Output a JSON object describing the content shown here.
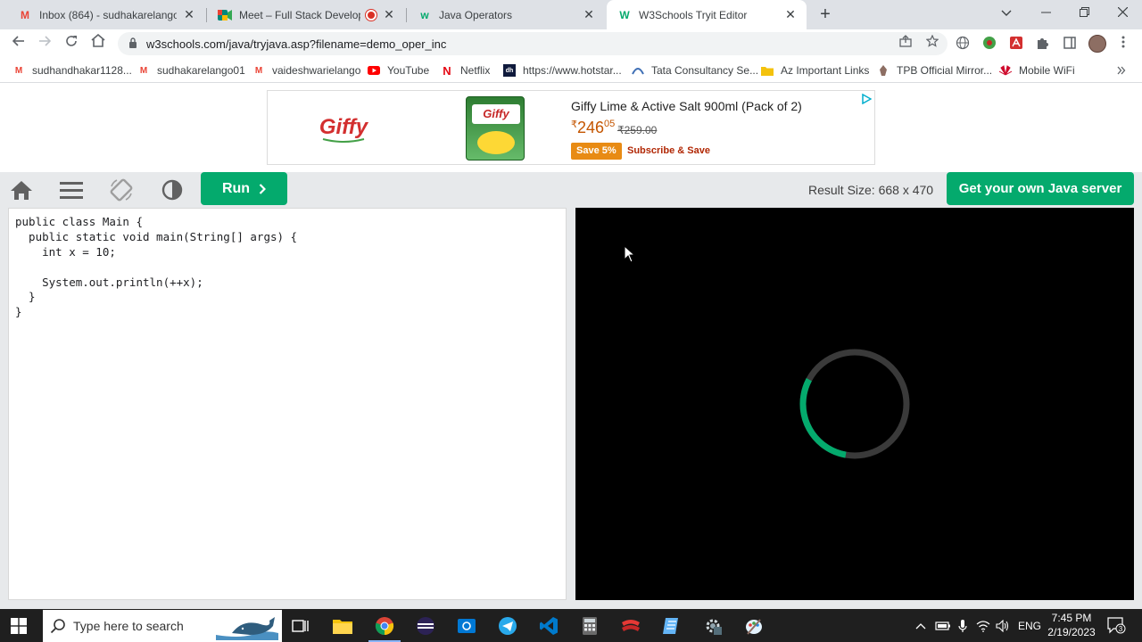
{
  "browser": {
    "tabs": [
      {
        "title": "Inbox (864) - sudhakarelango01@",
        "icon": "gmail-icon",
        "color": "#ea4335"
      },
      {
        "title": "Meet – Full Stack Developer",
        "icon": "google-meet-icon",
        "color": "#00897b"
      },
      {
        "title": "Java Operators",
        "icon": "w3schools-icon",
        "color": "#04aa6d"
      },
      {
        "title": "W3Schools Tryit Editor",
        "icon": "w3schools-icon",
        "color": "#04aa6d"
      }
    ],
    "close_glyph": "✕",
    "new_tab_glyph": "+",
    "url": "w3schools.com/java/tryjava.asp?filename=demo_oper_inc"
  },
  "bookmarks": [
    {
      "label": "sudhandhakar1128...",
      "icon": "gmail-icon"
    },
    {
      "label": "sudhakarelango01",
      "icon": "gmail-icon"
    },
    {
      "label": "vaideshwarielango",
      "icon": "gmail-icon"
    },
    {
      "label": "YouTube",
      "icon": "youtube-icon"
    },
    {
      "label": "Netflix",
      "icon": "netflix-icon"
    },
    {
      "label": "https://www.hotstar...",
      "icon": "hotstar-icon"
    },
    {
      "label": "Tata Consultancy Se...",
      "icon": "tcs-icon"
    },
    {
      "label": "Az Important Links",
      "icon": "folder-icon"
    },
    {
      "label": "TPB Official Mirror...",
      "icon": "tpb-icon"
    },
    {
      "label": "Mobile WiFi",
      "icon": "huawei-icon"
    }
  ],
  "ad": {
    "brand": "Giffy",
    "product_label": "Giffy",
    "title": "Giffy Lime & Active Salt 900ml (Pack of 2)",
    "currency": "₹",
    "price_main": "246",
    "price_fraction": "05",
    "old_price": "₹259.00",
    "save_badge": "Save 5%",
    "subscribe": "Subscribe & Save"
  },
  "tryit": {
    "run_label": "Run",
    "result_size": "Result Size: 668 x 470",
    "get_server_label": "Get your own Java server"
  },
  "editor": {
    "code_lines": [
      "public class Main {",
      "  public static void main(String[] args) {",
      "    int x = 10;",
      "",
      "    System.out.println(++x);",
      "  }",
      "}"
    ]
  },
  "result": {
    "loading_progress": 0.3,
    "accent": "#04aa6d"
  },
  "taskbar": {
    "search_placeholder": "Type here to search",
    "language": "ENG",
    "time": "7:45 PM",
    "date": "2/19/2023",
    "notification_count": "3"
  }
}
